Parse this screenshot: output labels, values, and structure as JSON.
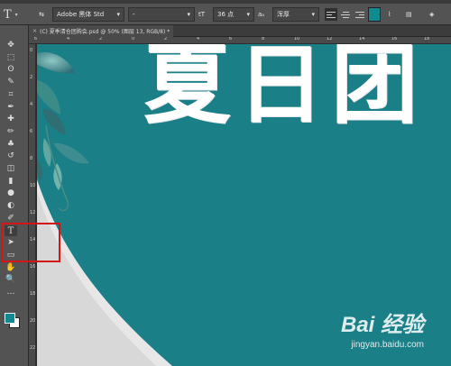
{
  "options_bar": {
    "font_family": "Adobe 黑体 Std",
    "font_style": "-",
    "font_size": "36 点",
    "aa_mode": "浑厚",
    "text_color": "#0f8a93"
  },
  "document_tab": {
    "title": "(C) 夏季清仓团购会.psd @ 50% (图层 13, RGB/8) *"
  },
  "rulers": {
    "horizontal_labels": [
      "6",
      "4",
      "2",
      "0",
      "2",
      "4",
      "6",
      "8",
      "10",
      "12",
      "14",
      "16",
      "18"
    ],
    "vertical_labels": [
      "0",
      "2",
      "4",
      "6",
      "8",
      "10",
      "12",
      "14",
      "16",
      "18",
      "20",
      "22"
    ]
  },
  "toolbar": {
    "tools": [
      {
        "name": "move-tool",
        "glyph": "✥"
      },
      {
        "name": "marquee-tool",
        "glyph": "⬚"
      },
      {
        "name": "lasso-tool",
        "glyph": "ʘ"
      },
      {
        "name": "quick-select-tool",
        "glyph": "✎"
      },
      {
        "name": "crop-tool",
        "glyph": "⌗"
      },
      {
        "name": "eyedropper-tool",
        "glyph": "✒"
      },
      {
        "name": "healing-brush-tool",
        "glyph": "✚"
      },
      {
        "name": "brush-tool",
        "glyph": "✏"
      },
      {
        "name": "clone-stamp-tool",
        "glyph": "♣"
      },
      {
        "name": "history-brush-tool",
        "glyph": "↺"
      },
      {
        "name": "eraser-tool",
        "glyph": "◫"
      },
      {
        "name": "gradient-tool",
        "glyph": "▮"
      },
      {
        "name": "blur-tool",
        "glyph": "●"
      },
      {
        "name": "dodge-tool",
        "glyph": "◐"
      },
      {
        "name": "pen-tool",
        "glyph": "✐"
      },
      {
        "name": "type-tool",
        "glyph": "T"
      },
      {
        "name": "path-select-tool",
        "glyph": "➤"
      },
      {
        "name": "rectangle-tool",
        "glyph": "▭"
      },
      {
        "name": "hand-tool",
        "glyph": "✋"
      },
      {
        "name": "zoom-tool",
        "glyph": "🔍"
      },
      {
        "name": "more-tools",
        "glyph": "…"
      }
    ],
    "foreground_color": "#0f8a93",
    "background_color": "#ffffff"
  },
  "canvas": {
    "headline": "夏日团",
    "background_color": "#1a7f87"
  },
  "watermark": {
    "logo": "Bai 经验",
    "url": "jingyan.baidu.com"
  }
}
